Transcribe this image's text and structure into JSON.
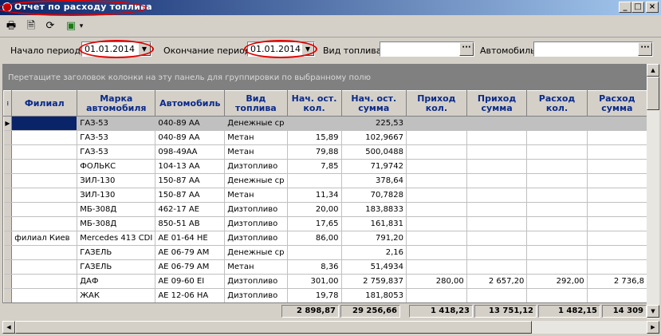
{
  "window": {
    "title": "Отчет по расходу топлива",
    "minimize_glyph": "_",
    "maximize_glyph": "□",
    "close_glyph": "×"
  },
  "toolbar": {
    "buttons": [
      {
        "icon": "print-icon",
        "glyph": "🖶"
      },
      {
        "icon": "print-preview-icon",
        "glyph": "🗎"
      },
      {
        "icon": "refresh-icon",
        "glyph": "⟳"
      },
      {
        "icon": "export-excel-icon",
        "glyph": "▣",
        "dropdown_glyph": "▾"
      }
    ]
  },
  "filters": {
    "start_label": "Начало периода:",
    "start_value": "01.01.2014",
    "end_label": "Окончание периода:",
    "end_value": "01.01.2014",
    "fuel_label": "Вид топлива:",
    "fuel_value": "",
    "car_label": "Автомобиль:",
    "car_value": "",
    "dropdown_glyph": "▼",
    "ellipsis_glyph": "···"
  },
  "group_panel_text": "Перетащите заголовок колонки на эту панель для группировки по выбранному полю",
  "grid": {
    "row_indicator_glyph": "▶",
    "columns": [
      {
        "label": "Филиал"
      },
      {
        "label": "Марка\nавтомобиля"
      },
      {
        "label": "Автомобиль"
      },
      {
        "label": "Вид\nтоплива"
      },
      {
        "label": "Нач. ост.\nкол."
      },
      {
        "label": "Нач. ост.\nсумма"
      },
      {
        "label": "Приход кол."
      },
      {
        "label": "Приход\nсумма"
      },
      {
        "label": "Расход кол."
      },
      {
        "label": "Расход\nсумма"
      }
    ],
    "rows": [
      [
        "",
        "ГАЗ-53",
        "040-89 АА",
        "Денежные ср",
        "",
        "225,53",
        "",
        "",
        "",
        ""
      ],
      [
        "",
        "ГАЗ-53",
        "040-89 АА",
        "Метан",
        "15,89",
        "102,9667",
        "",
        "",
        "",
        ""
      ],
      [
        "",
        "ГАЗ-53",
        "098-49АА",
        "Метан",
        "79,88",
        "500,0488",
        "",
        "",
        "",
        ""
      ],
      [
        "",
        "ФОЛЬКС",
        "104-13 АА",
        "Дизтопливо",
        "7,85",
        "71,9742",
        "",
        "",
        "",
        ""
      ],
      [
        "",
        "ЗИЛ-130",
        "150-87 АА",
        "Денежные ср",
        "",
        "378,64",
        "",
        "",
        "",
        ""
      ],
      [
        "",
        "ЗИЛ-130",
        "150-87 АА",
        "Метан",
        "11,34",
        "70,7828",
        "",
        "",
        "",
        ""
      ],
      [
        "",
        "МБ-308Д",
        "462-17 АЕ",
        "Дизтопливо",
        "20,00",
        "183,8833",
        "",
        "",
        "",
        ""
      ],
      [
        "",
        "МБ-308Д",
        "850-51 АВ",
        "Дизтопливо",
        "17,65",
        "161,831",
        "",
        "",
        "",
        ""
      ],
      [
        "филиал Киев",
        "Mercedes 413 CDI",
        "АЕ 01-64 НЕ",
        "Дизтопливо",
        "86,00",
        "791,20",
        "",
        "",
        "",
        ""
      ],
      [
        "",
        "ГАЗЕЛЬ",
        "АЕ 06-79 АМ",
        "Денежные ср",
        "",
        "2,16",
        "",
        "",
        "",
        ""
      ],
      [
        "",
        "ГАЗЕЛЬ",
        "АЕ 06-79 АМ",
        "Метан",
        "8,36",
        "51,4934",
        "",
        "",
        "",
        ""
      ],
      [
        "",
        "ДАФ",
        "АЕ 09-60 ЕI",
        "Дизтопливо",
        "301,00",
        "2 759,837",
        "280,00",
        "2 657,20",
        "292,00",
        "2 736,8"
      ],
      [
        "",
        "ЖАК",
        "АЕ 12-06 НА",
        "Дизтопливо",
        "19,78",
        "181,8053",
        "",
        "",
        "",
        ""
      ]
    ],
    "totals": [
      "2 898,87",
      "29 256,66",
      "1 418,23",
      "13 751,12",
      "1 482,15",
      "14 309"
    ]
  },
  "scroll": {
    "up": "▲",
    "down": "▼",
    "left": "◀",
    "right": "▶"
  },
  "colors": {
    "title_start": "#0a246a",
    "title_end": "#a6caf0",
    "header_text": "#0a2a8a",
    "highlight": "#e00000",
    "selection": "#0a246a"
  }
}
